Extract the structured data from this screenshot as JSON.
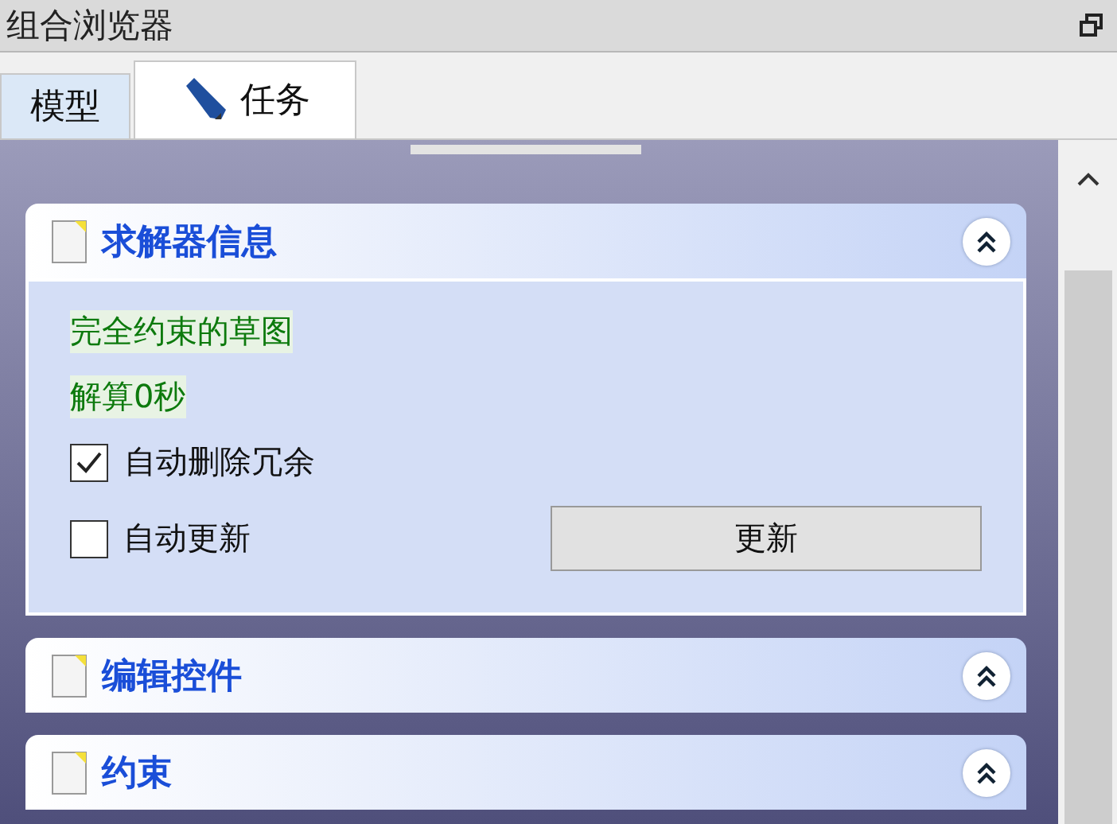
{
  "window": {
    "title": "组合浏览器"
  },
  "tabs": [
    {
      "label": "模型",
      "selected": false,
      "icon": false
    },
    {
      "label": "任务",
      "selected": true,
      "icon": true
    }
  ],
  "panels": [
    {
      "title": "求解器信息",
      "body": [
        {
          "kind": "message",
          "text": "完全约束的草图"
        },
        {
          "kind": "message",
          "text": "解算0秒"
        },
        {
          "kind": "checkbox",
          "label": "自动删除冗余",
          "checked": true
        },
        {
          "kind": "checkbox",
          "label": "自动更新",
          "checked": false,
          "button": "更新"
        }
      ]
    },
    {
      "title": "编辑控件"
    },
    {
      "title": "约束"
    }
  ]
}
